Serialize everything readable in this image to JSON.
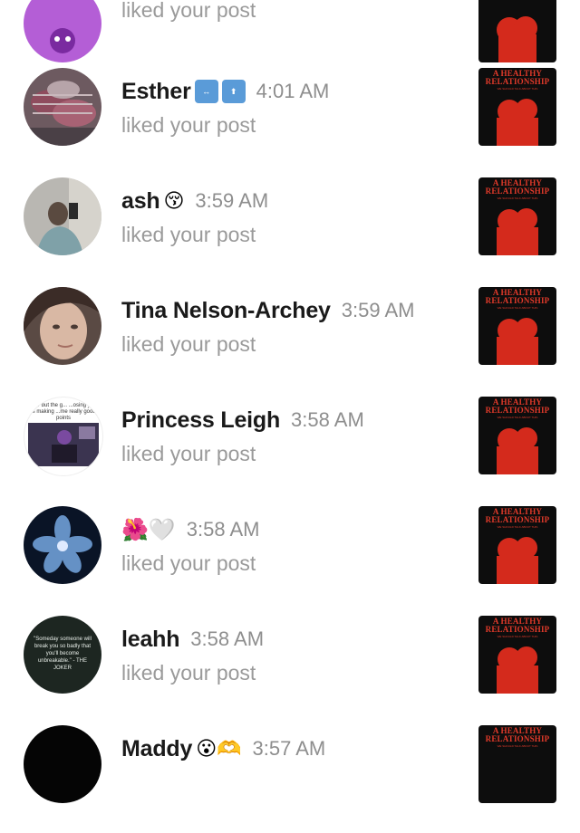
{
  "notifications": [
    {
      "name": "",
      "emoji": "",
      "time": "",
      "action": "liked your post",
      "avatar": "purple"
    },
    {
      "name": "Esther",
      "emoji": "↔️ ⬆️",
      "time": "4:01 AM",
      "action": "liked your post",
      "avatar": "pink-pattern"
    },
    {
      "name": "ash",
      "emoji": "😚",
      "time": "3:59 AM",
      "action": "liked your post",
      "avatar": "photo-grey"
    },
    {
      "name": "Tina Nelson-Archey",
      "emoji": "",
      "time": "3:59 AM",
      "action": "liked your post",
      "avatar": "face"
    },
    {
      "name": "Princess Leigh",
      "emoji": "",
      "time": "3:58 AM",
      "action": "liked your post",
      "avatar": "meme"
    },
    {
      "name": "",
      "emoji": "🌺🤍",
      "time": "3:58 AM",
      "action": "liked your post",
      "avatar": "blue-flower"
    },
    {
      "name": "leahh",
      "emoji": "",
      "time": "3:58 AM",
      "action": "liked your post",
      "avatar": "joker-quote"
    },
    {
      "name": "Maddy",
      "emoji": "😮🫶",
      "time": "3:57 AM",
      "action": "",
      "avatar": "black"
    }
  ],
  "post_thumbnail": {
    "title_line1": "A HEALTHY",
    "title_line2": "RELATIONSHIP",
    "subtitle": "WE SHOULD TALK ABOUT THIS",
    "accent_color": "#e23a2a",
    "background": "#0d0d0d"
  },
  "avatar_text": {
    "princess": "...er but the g... ...osing you is making ...me really good points",
    "leahh": "\"Someday someone will break you so badly that you'll become unbreakable.\" - THE JOKER"
  }
}
